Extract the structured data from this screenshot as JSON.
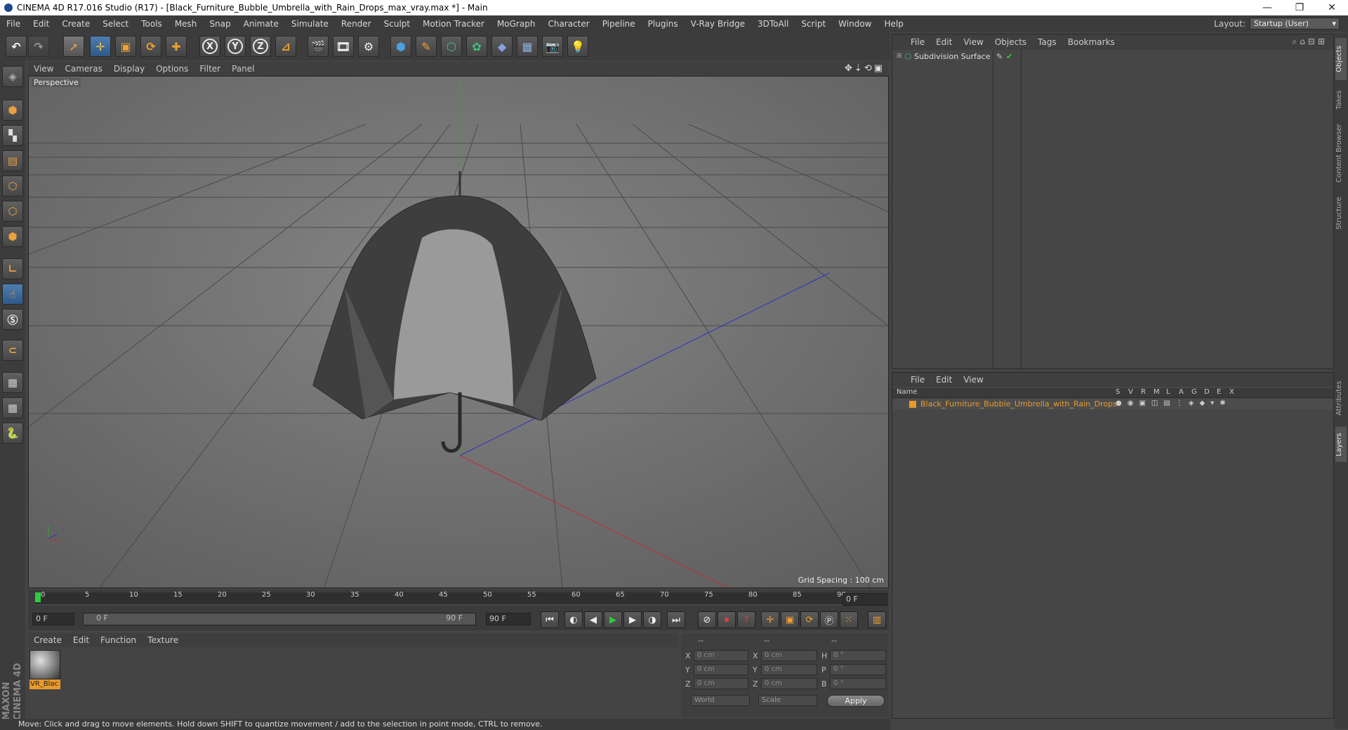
{
  "window": {
    "title": "CINEMA 4D R17.016 Studio (R17) - [Black_Furniture_Bubble_Umbrella_with_Rain_Drops_max_vray.max *] - Main",
    "minimize": "—",
    "restore": "❐",
    "close": "✕"
  },
  "menu": [
    "File",
    "Edit",
    "Create",
    "Select",
    "Tools",
    "Mesh",
    "Snap",
    "Animate",
    "Simulate",
    "Render",
    "Sculpt",
    "Motion Tracker",
    "MoGraph",
    "Character",
    "Pipeline",
    "Plugins",
    "V-Ray Bridge",
    "3DToAll",
    "Script",
    "Window",
    "Help"
  ],
  "layout": {
    "label": "Layout:",
    "value": "Startup (User)"
  },
  "toolbar": {
    "x": "X",
    "y": "Y",
    "z": "Z"
  },
  "viewport": {
    "menu": [
      "View",
      "Cameras",
      "Display",
      "Options",
      "Filter",
      "Panel"
    ],
    "camera_label": "Perspective",
    "grid_spacing": "Grid Spacing : 100 cm"
  },
  "timeline": {
    "ticks": [
      "0",
      "5",
      "10",
      "15",
      "20",
      "25",
      "30",
      "35",
      "40",
      "45",
      "50",
      "55",
      "60",
      "65",
      "70",
      "75",
      "80",
      "85",
      "90"
    ],
    "current_frame": "0 F",
    "start_field": "0 F",
    "range_start": "0 F",
    "range_end": "90 F",
    "end_field": "90 F"
  },
  "material_manager": {
    "menu": [
      "Create",
      "Edit",
      "Function",
      "Texture"
    ],
    "material_name": "VR_Blac"
  },
  "coordinates": {
    "header": [
      "--",
      "--",
      "--"
    ],
    "rows": [
      {
        "a": "X",
        "av": "0 cm",
        "b": "X",
        "bv": "0 cm",
        "c": "H",
        "cv": "0 °"
      },
      {
        "a": "Y",
        "av": "0 cm",
        "b": "Y",
        "bv": "0 cm",
        "c": "P",
        "cv": "0 °"
      },
      {
        "a": "Z",
        "av": "0 cm",
        "b": "Z",
        "bv": "0 cm",
        "c": "B",
        "cv": "0 °"
      }
    ],
    "world": "World",
    "scale": "Scale",
    "apply": "Apply"
  },
  "status": "Move: Click and drag to move elements. Hold down SHIFT to quantize movement / add to the selection in point mode, CTRL to remove.",
  "objects_panel": {
    "menu": [
      "File",
      "Edit",
      "View",
      "Objects",
      "Tags",
      "Bookmarks"
    ],
    "object": "Subdivision Surface"
  },
  "layers_panel": {
    "menu": [
      "File",
      "Edit",
      "View"
    ],
    "columns": [
      "Name",
      "S",
      "V",
      "R",
      "M",
      "L",
      "A",
      "G",
      "D",
      "E",
      "X"
    ],
    "layer": "Black_Furniture_Bubble_Umbrella_with_Rain_Drops"
  },
  "side_tabs": [
    "Objects",
    "Takes",
    "Content Browser",
    "Structure",
    "Attributes",
    "Layers"
  ],
  "branding": "MAXON CINEMA 4D",
  "colors": {
    "layer_orange": "#e89a2c",
    "x_axis": "#c03030",
    "y_axis": "#30a030",
    "z_axis": "#3030c0"
  }
}
